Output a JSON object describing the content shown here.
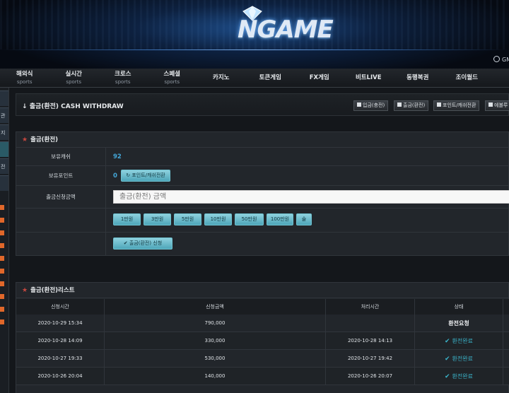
{
  "header": {
    "logo_text": "NGAME",
    "clock": "GM"
  },
  "nav": [
    {
      "label": "해외식",
      "sub": "sports"
    },
    {
      "label": "실시간",
      "sub": "sports"
    },
    {
      "label": "크로스",
      "sub": "sports"
    },
    {
      "label": "스페셜",
      "sub": "sports"
    },
    {
      "label": "카지노",
      "sub": ""
    },
    {
      "label": "토큰게임",
      "sub": ""
    },
    {
      "label": "FX게임",
      "sub": ""
    },
    {
      "label": "비트LIVE",
      "sub": ""
    },
    {
      "label": "동행복권",
      "sub": ""
    },
    {
      "label": "조이월드",
      "sub": ""
    }
  ],
  "sidebar": {
    "tabs": [
      "관",
      "지",
      "",
      "전",
      ""
    ]
  },
  "page": {
    "title": "출금(환전) CASH WITHDRAW",
    "buttons": [
      "입금(충전)",
      "출금(환전)",
      "포인트/캐쉬전환",
      "에볼루"
    ]
  },
  "withdraw": {
    "title": "출금(환전)",
    "cash_label": "보유캐쉬",
    "cash_value": "92",
    "point_label": "보유포인트",
    "point_value": "0",
    "point_convert_button": "포인트/캐쉬전환",
    "amount_label": "출금신청금액",
    "amount_placeholder": "출금(환전) 금액",
    "quick_amounts": [
      "1만원",
      "3만원",
      "5만원",
      "10만원",
      "50만원",
      "100만원",
      "술"
    ],
    "submit_button": "출금(환전) 신청"
  },
  "history": {
    "title": "출금(환전)리스트",
    "columns": [
      "신청시간",
      "신청금액",
      "처리시간",
      "상태"
    ],
    "rows": [
      {
        "requested": "2020-10-29 15:34",
        "amount": "790,000",
        "processed": "",
        "status": "환전요청",
        "done": false
      },
      {
        "requested": "2020-10-28 14:09",
        "amount": "330,000",
        "processed": "2020-10-28 14:13",
        "status": "환전완료",
        "done": true
      },
      {
        "requested": "2020-10-27 19:33",
        "amount": "530,000",
        "processed": "2020-10-27 19:42",
        "status": "환전완료",
        "done": true
      },
      {
        "requested": "2020-10-26 20:04",
        "amount": "140,000",
        "processed": "2020-10-26 20:07",
        "status": "환전완료",
        "done": true
      }
    ]
  },
  "colors": {
    "accent": "#44a7d9",
    "button": "#5fb4c6",
    "star": "#c4473f"
  }
}
